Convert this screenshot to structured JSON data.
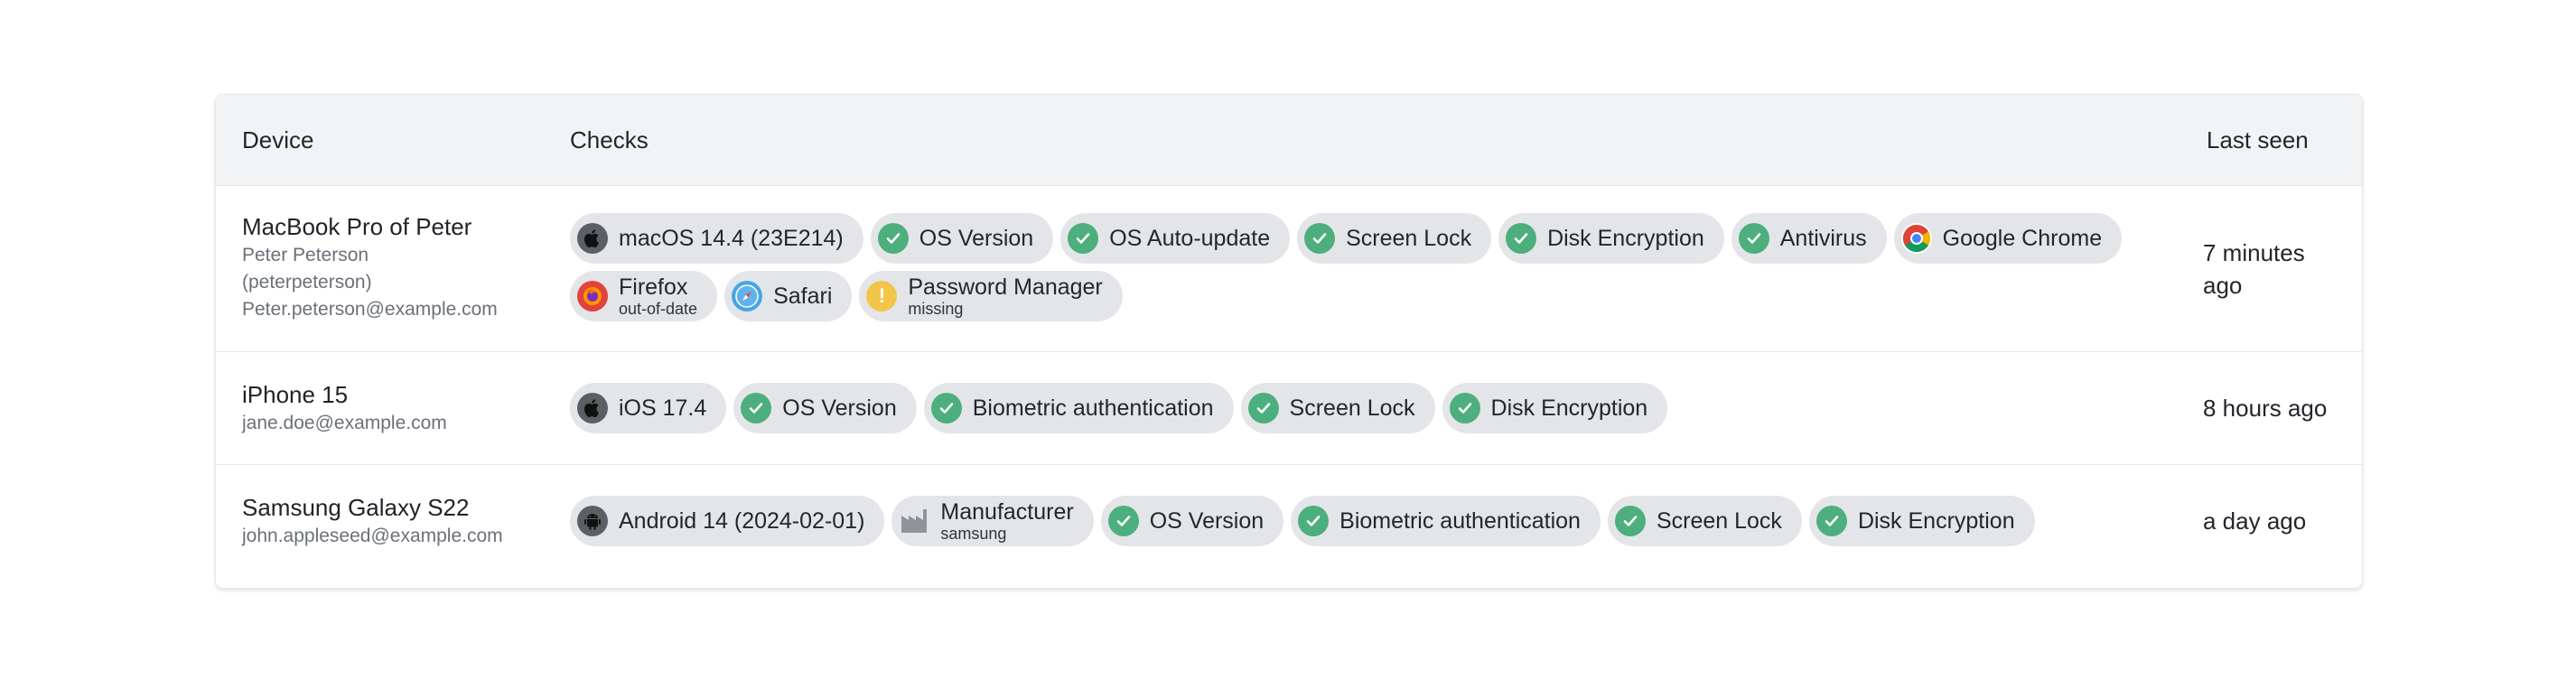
{
  "table": {
    "headers": {
      "device": "Device",
      "checks": "Checks",
      "last_seen": "Last seen"
    },
    "rows": [
      {
        "device_name": "MacBook Pro of Peter",
        "owner_line1": "Peter Peterson",
        "owner_line2": "(peterpeterson)",
        "email": "Peter.peterson@example.com",
        "last_seen_line1": "7 minutes",
        "last_seen_line2": "ago",
        "checks": [
          {
            "label": "macOS 14.4 (23E214)",
            "icon": "apple-icon",
            "status": "info"
          },
          {
            "label": "OS Version",
            "icon": "check-icon",
            "status": "ok"
          },
          {
            "label": "OS Auto-update",
            "icon": "check-icon",
            "status": "ok"
          },
          {
            "label": "Screen Lock",
            "icon": "check-icon",
            "status": "ok"
          },
          {
            "label": "Disk Encryption",
            "icon": "check-icon",
            "status": "ok"
          },
          {
            "label": "Antivirus",
            "icon": "check-icon",
            "status": "ok"
          },
          {
            "label": "Google Chrome",
            "icon": "chrome-icon",
            "status": "info"
          },
          {
            "label": "Firefox",
            "sublabel": "out-of-date",
            "icon": "firefox-icon",
            "status": "warn"
          },
          {
            "label": "Safari",
            "icon": "safari-icon",
            "status": "info"
          },
          {
            "label": "Password Manager",
            "sublabel": "missing",
            "icon": "warning-icon",
            "status": "warn"
          }
        ]
      },
      {
        "device_name": "iPhone 15",
        "email": "jane.doe@example.com",
        "last_seen": "8 hours ago",
        "checks": [
          {
            "label": "iOS 17.4",
            "icon": "apple-icon",
            "status": "info"
          },
          {
            "label": "OS Version",
            "icon": "check-icon",
            "status": "ok"
          },
          {
            "label": "Biometric authentication",
            "icon": "check-icon",
            "status": "ok"
          },
          {
            "label": "Screen Lock",
            "icon": "check-icon",
            "status": "ok"
          },
          {
            "label": "Disk Encryption",
            "icon": "check-icon",
            "status": "ok"
          }
        ]
      },
      {
        "device_name": "Samsung Galaxy S22",
        "email": "john.appleseed@example.com",
        "last_seen": "a day ago",
        "checks": [
          {
            "label": "Android 14 (2024-02-01)",
            "icon": "android-icon",
            "status": "info"
          },
          {
            "label": "Manufacturer",
            "sublabel": "samsung",
            "icon": "factory-icon",
            "status": "info"
          },
          {
            "label": "OS Version",
            "icon": "check-icon",
            "status": "ok"
          },
          {
            "label": "Biometric authentication",
            "icon": "check-icon",
            "status": "ok"
          },
          {
            "label": "Screen Lock",
            "icon": "check-icon",
            "status": "ok"
          },
          {
            "label": "Disk Encryption",
            "icon": "check-icon",
            "status": "ok"
          }
        ]
      }
    ]
  },
  "colors": {
    "ok": "#4caf7d",
    "warning": "#f2c54b",
    "chip_bg": "#e4e5e8",
    "header_bg": "#f2f3f4"
  }
}
